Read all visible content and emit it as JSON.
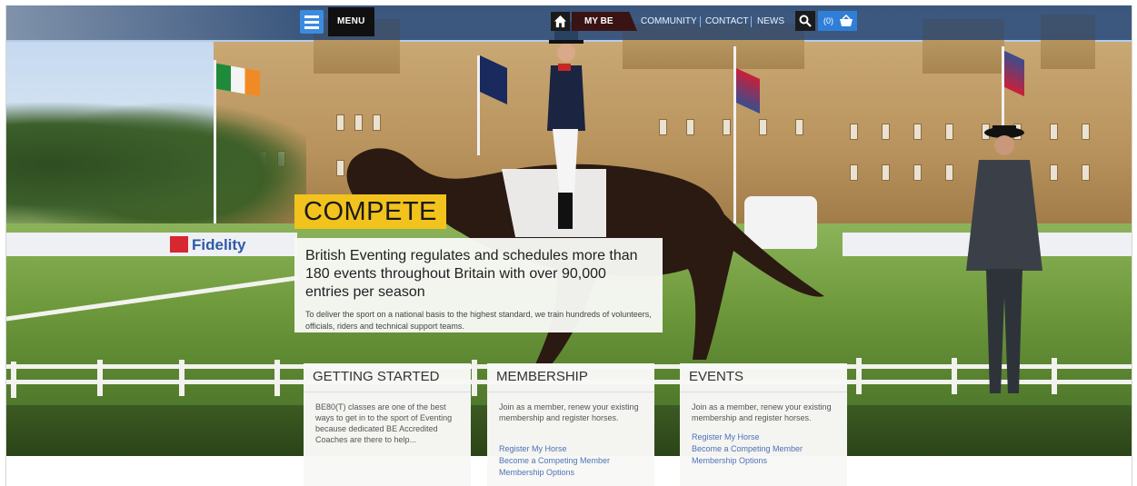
{
  "nav": {
    "menu_label": "MENU",
    "mybe_label": "MY BE",
    "links": [
      "COMMUNITY",
      "CONTACT",
      "NEWS"
    ],
    "basket_count": "(0)"
  },
  "hero": {
    "sponsor": "Fidelity",
    "compete_tag": "COMPETE",
    "headline": "British Eventing regulates and schedules more than 180 events throughout Britain with over 90,000 entries per season",
    "subtext": "To deliver the sport on a national basis to the highest standard, we train hundreds of volunteers, officials, riders and technical support teams."
  },
  "cards": [
    {
      "title": "GETTING STARTED",
      "body": "BE80(T) classes are one of the best ways to get in to the sport of Eventing because dedicated BE Accredited Coaches are there to help...",
      "links": []
    },
    {
      "title": "MEMBERSHIP",
      "body": "Join as a member, renew your existing membership and register horses.",
      "links": [
        "Register My Horse",
        "Become a Competing Member",
        "Membership Options"
      ]
    },
    {
      "title": "EVENTS",
      "body": "Join as a member, renew your existing membership and register horses.",
      "links": [
        "Register My Horse",
        "Become a Competing Member",
        "Membership Options"
      ]
    }
  ],
  "colors": {
    "accent_yellow": "#f2c21d",
    "nav_blue": "#2f7fd8",
    "link_blue": "#4e72b6"
  }
}
